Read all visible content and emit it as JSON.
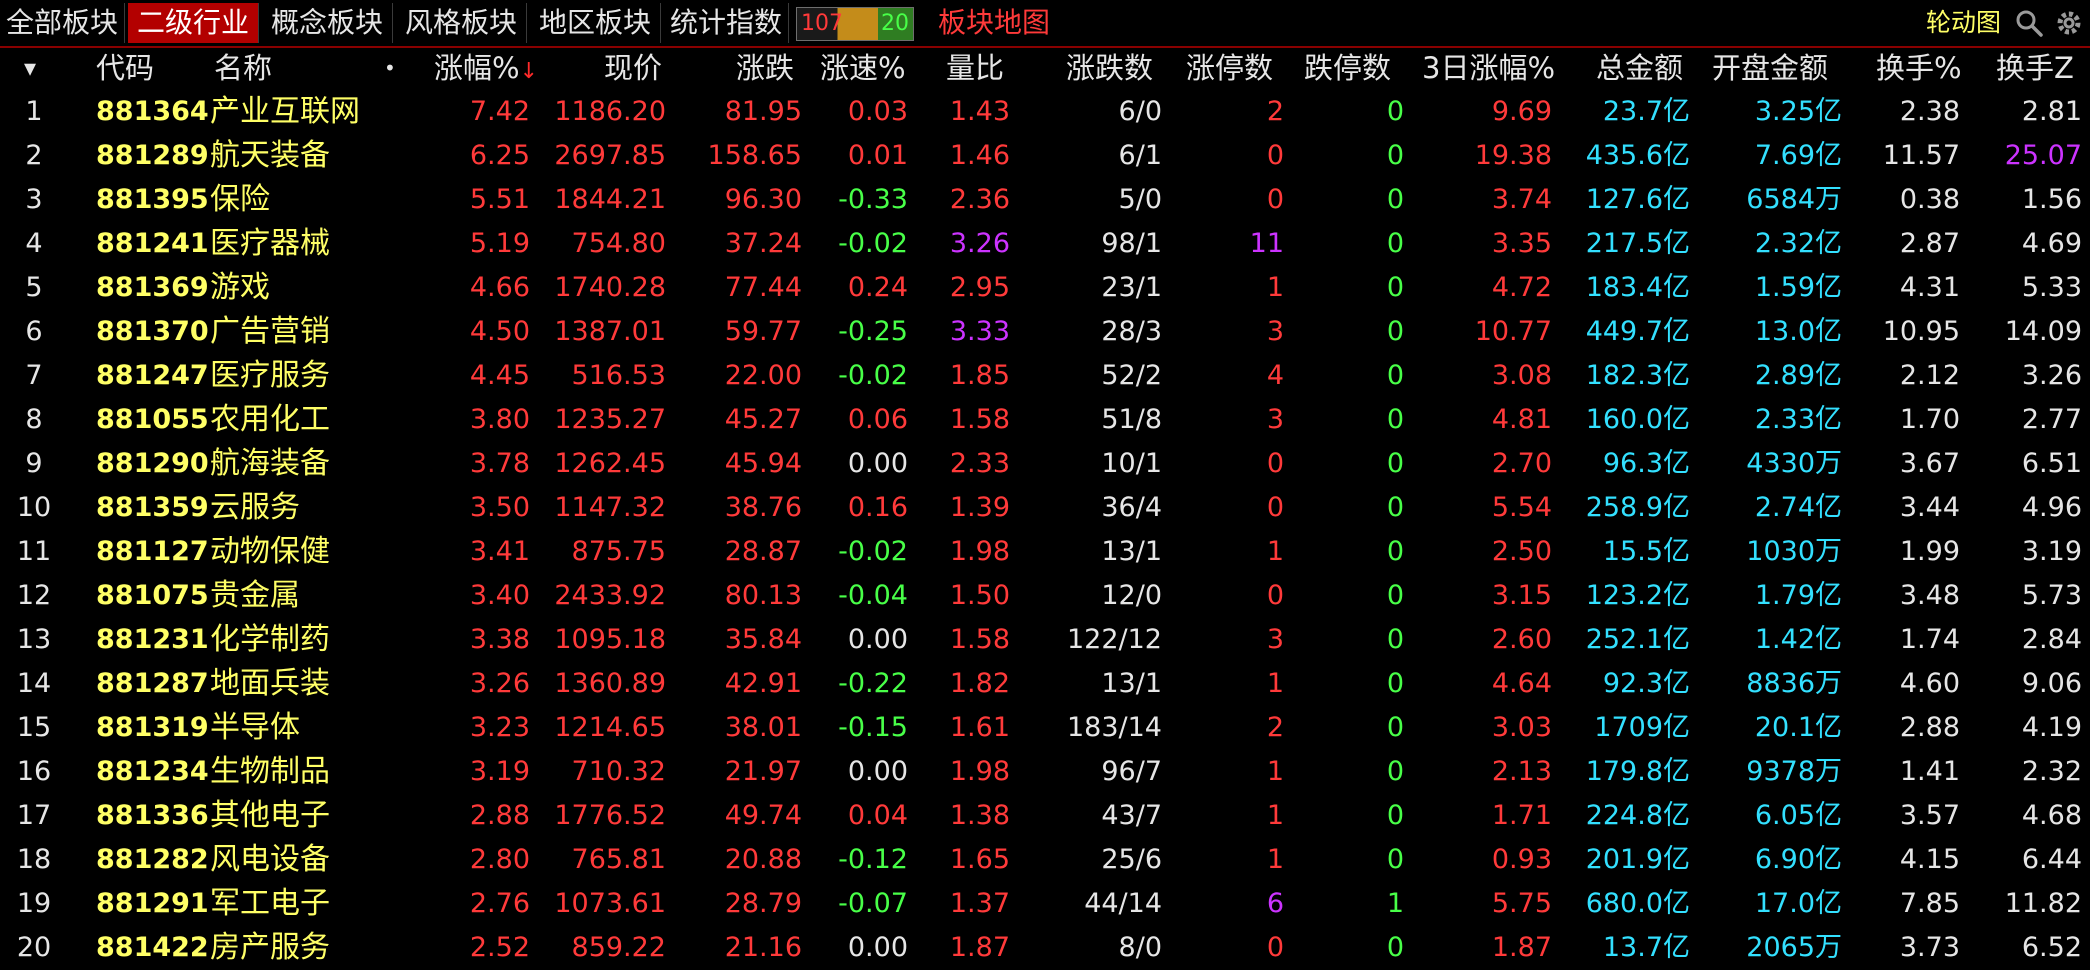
{
  "tabs": [
    {
      "label": "全部板块"
    },
    {
      "label": "二级行业"
    },
    {
      "label": "概念板块"
    },
    {
      "label": "风格板块"
    },
    {
      "label": "地区板块"
    },
    {
      "label": "统计指数"
    }
  ],
  "active_tab_index": 1,
  "counter": {
    "up": "107",
    "down": "20"
  },
  "map_link": "板块地图",
  "rotate_label": "轮动图",
  "icons": [
    "search-icon",
    "gear-icon",
    "sort-down-arrow-icon",
    "column-menu-icon"
  ],
  "colors": {
    "rise": "#ff3a3a",
    "fall": "#48ff48",
    "code": "#ffff66",
    "amount": "#33e0ff",
    "highlight": "#cc33ff",
    "active_tab": "#b30000"
  },
  "columns": {
    "menu": "▾",
    "code": "代码",
    "name": "名称",
    "dot": "•",
    "pct": "涨幅%",
    "sort": "↓",
    "price": "现价",
    "change": "涨跌",
    "speed": "涨速%",
    "ratio": "量比",
    "updown": "涨跌数",
    "limit_up": "涨停数",
    "limit_down": "跌停数",
    "pct3d": "3日涨幅%",
    "total_amount": "总金额",
    "open_amount": "开盘金额",
    "turnover": "换手%",
    "turnover_z": "换手Z"
  },
  "rows": [
    {
      "idx": "1",
      "code": "881364",
      "name": "产业互联网",
      "pct": "7.42",
      "price": "1186.20",
      "change": "81.95",
      "speed": "0.03",
      "speed_color": "red",
      "ratio": "1.43",
      "ratio_color": "red",
      "updown": "6/0",
      "limit_up": "2",
      "limit_up_color": "red",
      "limit_down": "0",
      "pct3d": "9.69",
      "total": "23.7亿",
      "open": "3.25亿",
      "turnover": "2.38",
      "turnover_z": "2.81",
      "turnover_z_color": "white"
    },
    {
      "idx": "2",
      "code": "881289",
      "name": "航天装备",
      "pct": "6.25",
      "price": "2697.85",
      "change": "158.65",
      "speed": "0.01",
      "speed_color": "red",
      "ratio": "1.46",
      "ratio_color": "red",
      "updown": "6/1",
      "limit_up": "0",
      "limit_up_color": "red",
      "limit_down": "0",
      "pct3d": "19.38",
      "total": "435.6亿",
      "open": "7.69亿",
      "turnover": "11.57",
      "turnover_z": "25.07",
      "turnover_z_color": "purple"
    },
    {
      "idx": "3",
      "code": "881395",
      "name": "保险",
      "pct": "5.51",
      "price": "1844.21",
      "change": "96.30",
      "speed": "-0.33",
      "speed_color": "green",
      "ratio": "2.36",
      "ratio_color": "red",
      "updown": "5/0",
      "limit_up": "0",
      "limit_up_color": "red",
      "limit_down": "0",
      "pct3d": "3.74",
      "total": "127.6亿",
      "open": "6584万",
      "turnover": "0.38",
      "turnover_z": "1.56",
      "turnover_z_color": "white"
    },
    {
      "idx": "4",
      "code": "881241",
      "name": "医疗器械",
      "pct": "5.19",
      "price": "754.80",
      "change": "37.24",
      "speed": "-0.02",
      "speed_color": "green",
      "ratio": "3.26",
      "ratio_color": "purple",
      "updown": "98/1",
      "limit_up": "11",
      "limit_up_color": "purple",
      "limit_down": "0",
      "pct3d": "3.35",
      "total": "217.5亿",
      "open": "2.32亿",
      "turnover": "2.87",
      "turnover_z": "4.69",
      "turnover_z_color": "white"
    },
    {
      "idx": "5",
      "code": "881369",
      "name": "游戏",
      "pct": "4.66",
      "price": "1740.28",
      "change": "77.44",
      "speed": "0.24",
      "speed_color": "red",
      "ratio": "2.95",
      "ratio_color": "red",
      "updown": "23/1",
      "limit_up": "1",
      "limit_up_color": "red",
      "limit_down": "0",
      "pct3d": "4.72",
      "total": "183.4亿",
      "open": "1.59亿",
      "turnover": "4.31",
      "turnover_z": "5.33",
      "turnover_z_color": "white"
    },
    {
      "idx": "6",
      "code": "881370",
      "name": "广告营销",
      "pct": "4.50",
      "price": "1387.01",
      "change": "59.77",
      "speed": "-0.25",
      "speed_color": "green",
      "ratio": "3.33",
      "ratio_color": "purple",
      "updown": "28/3",
      "limit_up": "3",
      "limit_up_color": "red",
      "limit_down": "0",
      "pct3d": "10.77",
      "total": "449.7亿",
      "open": "13.0亿",
      "turnover": "10.95",
      "turnover_z": "14.09",
      "turnover_z_color": "white"
    },
    {
      "idx": "7",
      "code": "881247",
      "name": "医疗服务",
      "pct": "4.45",
      "price": "516.53",
      "change": "22.00",
      "speed": "-0.02",
      "speed_color": "green",
      "ratio": "1.85",
      "ratio_color": "red",
      "updown": "52/2",
      "limit_up": "4",
      "limit_up_color": "red",
      "limit_down": "0",
      "pct3d": "3.08",
      "total": "182.3亿",
      "open": "2.89亿",
      "turnover": "2.12",
      "turnover_z": "3.26",
      "turnover_z_color": "white"
    },
    {
      "idx": "8",
      "code": "881055",
      "name": "农用化工",
      "pct": "3.80",
      "price": "1235.27",
      "change": "45.27",
      "speed": "0.06",
      "speed_color": "red",
      "ratio": "1.58",
      "ratio_color": "red",
      "updown": "51/8",
      "limit_up": "3",
      "limit_up_color": "red",
      "limit_down": "0",
      "pct3d": "4.81",
      "total": "160.0亿",
      "open": "2.33亿",
      "turnover": "1.70",
      "turnover_z": "2.77",
      "turnover_z_color": "white"
    },
    {
      "idx": "9",
      "code": "881290",
      "name": "航海装备",
      "pct": "3.78",
      "price": "1262.45",
      "change": "45.94",
      "speed": "0.00",
      "speed_color": "white",
      "ratio": "2.33",
      "ratio_color": "red",
      "updown": "10/1",
      "limit_up": "0",
      "limit_up_color": "red",
      "limit_down": "0",
      "pct3d": "2.70",
      "total": "96.3亿",
      "open": "4330万",
      "turnover": "3.67",
      "turnover_z": "6.51",
      "turnover_z_color": "white"
    },
    {
      "idx": "10",
      "code": "881359",
      "name": "云服务",
      "pct": "3.50",
      "price": "1147.32",
      "change": "38.76",
      "speed": "0.16",
      "speed_color": "red",
      "ratio": "1.39",
      "ratio_color": "red",
      "updown": "36/4",
      "limit_up": "0",
      "limit_up_color": "red",
      "limit_down": "0",
      "pct3d": "5.54",
      "total": "258.9亿",
      "open": "2.74亿",
      "turnover": "3.44",
      "turnover_z": "4.96",
      "turnover_z_color": "white"
    },
    {
      "idx": "11",
      "code": "881127",
      "name": "动物保健",
      "pct": "3.41",
      "price": "875.75",
      "change": "28.87",
      "speed": "-0.02",
      "speed_color": "green",
      "ratio": "1.98",
      "ratio_color": "red",
      "updown": "13/1",
      "limit_up": "1",
      "limit_up_color": "red",
      "limit_down": "0",
      "pct3d": "2.50",
      "total": "15.5亿",
      "open": "1030万",
      "turnover": "1.99",
      "turnover_z": "3.19",
      "turnover_z_color": "white"
    },
    {
      "idx": "12",
      "code": "881075",
      "name": "贵金属",
      "pct": "3.40",
      "price": "2433.92",
      "change": "80.13",
      "speed": "-0.04",
      "speed_color": "green",
      "ratio": "1.50",
      "ratio_color": "red",
      "updown": "12/0",
      "limit_up": "0",
      "limit_up_color": "red",
      "limit_down": "0",
      "pct3d": "3.15",
      "total": "123.2亿",
      "open": "1.79亿",
      "turnover": "3.48",
      "turnover_z": "5.73",
      "turnover_z_color": "white"
    },
    {
      "idx": "13",
      "code": "881231",
      "name": "化学制药",
      "pct": "3.38",
      "price": "1095.18",
      "change": "35.84",
      "speed": "0.00",
      "speed_color": "white",
      "ratio": "1.58",
      "ratio_color": "red",
      "updown": "122/12",
      "limit_up": "3",
      "limit_up_color": "red",
      "limit_down": "0",
      "pct3d": "2.60",
      "total": "252.1亿",
      "open": "1.42亿",
      "turnover": "1.74",
      "turnover_z": "2.84",
      "turnover_z_color": "white"
    },
    {
      "idx": "14",
      "code": "881287",
      "name": "地面兵装",
      "pct": "3.26",
      "price": "1360.89",
      "change": "42.91",
      "speed": "-0.22",
      "speed_color": "green",
      "ratio": "1.82",
      "ratio_color": "red",
      "updown": "13/1",
      "limit_up": "1",
      "limit_up_color": "red",
      "limit_down": "0",
      "pct3d": "4.64",
      "total": "92.3亿",
      "open": "8836万",
      "turnover": "4.60",
      "turnover_z": "9.06",
      "turnover_z_color": "white"
    },
    {
      "idx": "15",
      "code": "881319",
      "name": "半导体",
      "pct": "3.23",
      "price": "1214.65",
      "change": "38.01",
      "speed": "-0.15",
      "speed_color": "green",
      "ratio": "1.61",
      "ratio_color": "red",
      "updown": "183/14",
      "limit_up": "2",
      "limit_up_color": "red",
      "limit_down": "0",
      "pct3d": "3.03",
      "total": "1709亿",
      "open": "20.1亿",
      "turnover": "2.88",
      "turnover_z": "4.19",
      "turnover_z_color": "white"
    },
    {
      "idx": "16",
      "code": "881234",
      "name": "生物制品",
      "pct": "3.19",
      "price": "710.32",
      "change": "21.97",
      "speed": "0.00",
      "speed_color": "white",
      "ratio": "1.98",
      "ratio_color": "red",
      "updown": "96/7",
      "limit_up": "1",
      "limit_up_color": "red",
      "limit_down": "0",
      "pct3d": "2.13",
      "total": "179.8亿",
      "open": "9378万",
      "turnover": "1.41",
      "turnover_z": "2.32",
      "turnover_z_color": "white"
    },
    {
      "idx": "17",
      "code": "881336",
      "name": "其他电子",
      "pct": "2.88",
      "price": "1776.52",
      "change": "49.74",
      "speed": "0.04",
      "speed_color": "red",
      "ratio": "1.38",
      "ratio_color": "red",
      "updown": "43/7",
      "limit_up": "1",
      "limit_up_color": "red",
      "limit_down": "0",
      "pct3d": "1.71",
      "total": "224.8亿",
      "open": "6.05亿",
      "turnover": "3.57",
      "turnover_z": "4.68",
      "turnover_z_color": "white"
    },
    {
      "idx": "18",
      "code": "881282",
      "name": "风电设备",
      "pct": "2.80",
      "price": "765.81",
      "change": "20.88",
      "speed": "-0.12",
      "speed_color": "green",
      "ratio": "1.65",
      "ratio_color": "red",
      "updown": "25/6",
      "limit_up": "1",
      "limit_up_color": "red",
      "limit_down": "0",
      "pct3d": "0.93",
      "total": "201.9亿",
      "open": "6.90亿",
      "turnover": "4.15",
      "turnover_z": "6.44",
      "turnover_z_color": "white"
    },
    {
      "idx": "19",
      "code": "881291",
      "name": "军工电子",
      "pct": "2.76",
      "price": "1073.61",
      "change": "28.79",
      "speed": "-0.07",
      "speed_color": "green",
      "ratio": "1.37",
      "ratio_color": "red",
      "updown": "44/14",
      "limit_up": "6",
      "limit_up_color": "purple",
      "limit_down": "1",
      "pct3d": "5.75",
      "total": "680.0亿",
      "open": "17.0亿",
      "turnover": "7.85",
      "turnover_z": "11.82",
      "turnover_z_color": "white"
    },
    {
      "idx": "20",
      "code": "881422",
      "name": "房产服务",
      "pct": "2.52",
      "price": "859.22",
      "change": "21.16",
      "speed": "0.00",
      "speed_color": "white",
      "ratio": "1.87",
      "ratio_color": "red",
      "updown": "8/0",
      "limit_up": "0",
      "limit_up_color": "red",
      "limit_down": "0",
      "pct3d": "1.87",
      "total": "13.7亿",
      "open": "2065万",
      "turnover": "3.73",
      "turnover_z": "6.52",
      "turnover_z_color": "white"
    }
  ]
}
